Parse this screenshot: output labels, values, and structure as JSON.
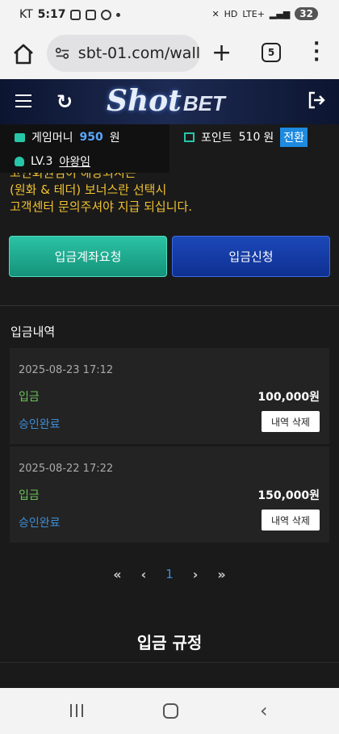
{
  "status_bar": {
    "carrier": "KT",
    "time": "5:17",
    "network": "LTE+",
    "battery": "32"
  },
  "browser": {
    "url": "sbt-01.com/wall",
    "tab_count": "5",
    "icons": [
      "home-icon",
      "site-settings-icon",
      "plus-icon",
      "tabs-icon",
      "more-icon"
    ]
  },
  "header": {
    "logo_main": "Shot",
    "logo_sub": "BET"
  },
  "account": {
    "game_money_label": "게임머니",
    "game_money_value": "950",
    "game_money_unit": "원",
    "point_label": "포인트",
    "point_value": "510",
    "point_unit": "원",
    "convert_label": "전환",
    "level": "LV.3",
    "nickname": "야왕임"
  },
  "notice": {
    "lines": [
      "고인회원님이 해당되시는",
      "(원화 & 테더) 보너스란 선택시",
      "고객센터 문의주셔야 지급 되십니다."
    ]
  },
  "actions": {
    "request_account": "입금계좌요청",
    "request_deposit": "입금신청"
  },
  "history": {
    "title": "입금내역",
    "records": [
      {
        "date": "2025-08-23 17:12",
        "type": "입금",
        "amount": "100,000원",
        "status": "승인완료",
        "delete_label": "내역 삭제"
      },
      {
        "date": "2025-08-22 17:22",
        "type": "입금",
        "amount": "150,000원",
        "status": "승인완료",
        "delete_label": "내역 삭제"
      }
    ]
  },
  "pagination": {
    "first": "«",
    "prev": "‹",
    "current": "1",
    "next": "›",
    "last": "»"
  },
  "rules": {
    "title": "입금 규정"
  },
  "colors": {
    "accent_teal": "#27c6a8",
    "accent_blue": "#1e8ae0",
    "notice_yellow": "#f2c230",
    "deposit_green": "#6bc35a"
  }
}
